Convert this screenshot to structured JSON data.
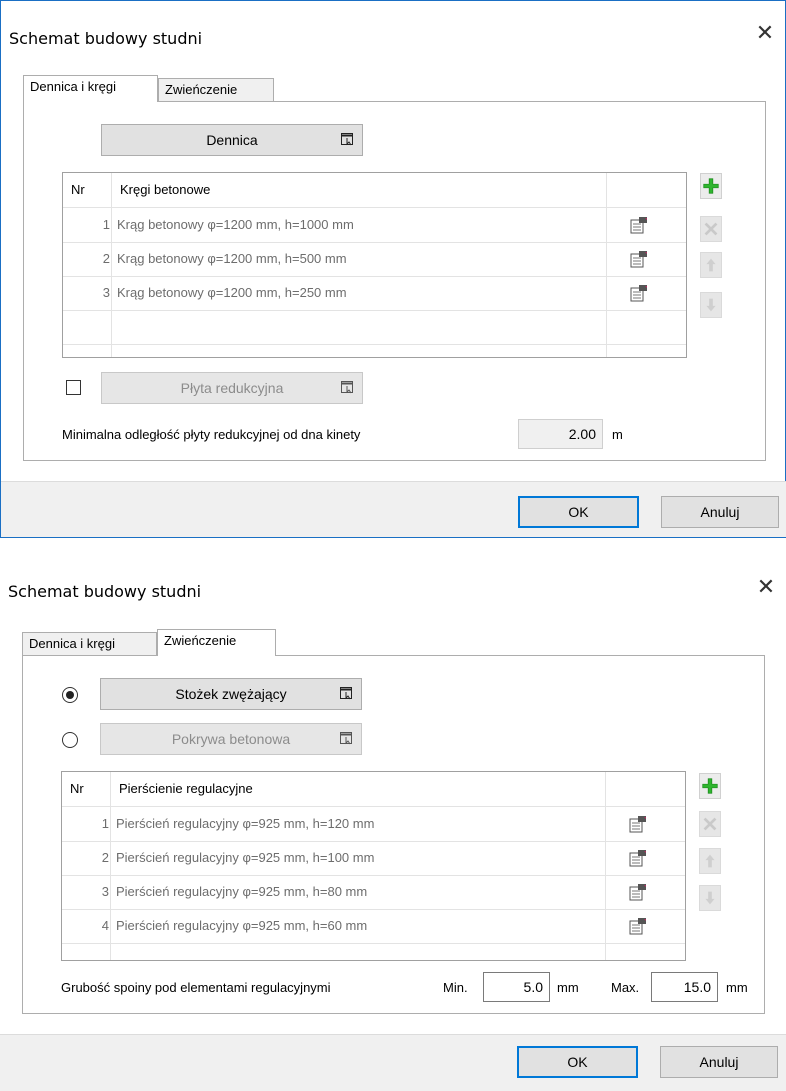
{
  "dialog1": {
    "title": "Schemat budowy studni",
    "tabs": [
      {
        "label": "Dennica i kręgi"
      },
      {
        "label": "Zwieńczenie"
      }
    ],
    "dennica_button": "Dennica",
    "grid": {
      "col_nr": "Nr",
      "col_desc": "Kręgi betonowe",
      "rows": [
        {
          "nr": "1",
          "desc": "Krąg betonowy φ=1200 mm, h=1000 mm"
        },
        {
          "nr": "2",
          "desc": "Krąg betonowy φ=1200 mm, h=500 mm"
        },
        {
          "nr": "3",
          "desc": "Krąg betonowy φ=1200 mm, h=250 mm"
        }
      ]
    },
    "plyta_checkbox_checked": false,
    "plyta_button": "Płyta redukcyjna",
    "min_distance_label": "Minimalna odległość płyty redukcyjnej od dna kinety",
    "min_distance_value": "2.00",
    "min_distance_unit": "m",
    "ok": "OK",
    "cancel": "Anuluj"
  },
  "dialog2": {
    "title": "Schemat budowy studni",
    "tabs": [
      {
        "label": "Dennica i kręgi"
      },
      {
        "label": "Zwieńczenie"
      }
    ],
    "radio_stozek_selected": true,
    "stozek_button": "Stożek zwężający",
    "pokrywa_button": "Pokrywa betonowa",
    "grid": {
      "col_nr": "Nr",
      "col_desc": "Pierścienie regulacyjne",
      "rows": [
        {
          "nr": "1",
          "desc": "Pierścień regulacyjny φ=925 mm, h=120 mm"
        },
        {
          "nr": "2",
          "desc": "Pierścień regulacyjny φ=925 mm, h=100 mm"
        },
        {
          "nr": "3",
          "desc": "Pierścień regulacyjny φ=925 mm, h=80 mm"
        },
        {
          "nr": "4",
          "desc": "Pierścień regulacyjny φ=925 mm, h=60 mm"
        }
      ]
    },
    "spoina_label": "Grubość spoiny pod elementami regulacyjnymi",
    "min_label": "Min.",
    "min_value": "5.0",
    "min_unit": "mm",
    "max_label": "Max.",
    "max_value": "15.0",
    "max_unit": "mm",
    "ok": "OK",
    "cancel": "Anuluj"
  },
  "icons": {
    "add": "plus-icon",
    "delete": "x-icon",
    "up": "arrow-up-icon",
    "down": "arrow-down-icon",
    "properties": "properties-icon",
    "dropdown": "dropdown-window-icon"
  },
  "colors": {
    "accent": "#0078d7",
    "add_green": "#2fb52f"
  }
}
